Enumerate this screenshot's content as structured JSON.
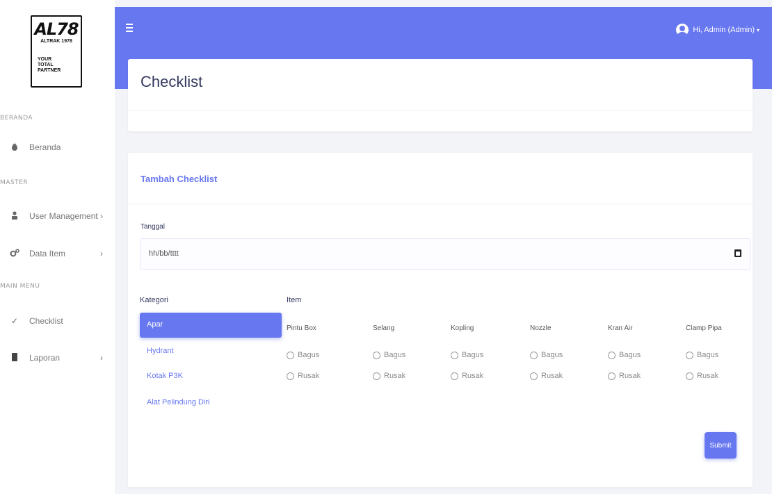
{
  "brand": {
    "logo_main": "AL78",
    "logo_sub": "ALTRAK 1978",
    "tagline": "YOUR\nTOTAL\nPARTNER"
  },
  "sidebar": {
    "sections": [
      "BERANDA",
      "MASTER",
      "MAIN MENU"
    ],
    "items": [
      {
        "label": "Beranda",
        "icon": "fire-icon"
      },
      {
        "label": "User Management",
        "icon": "user-icon"
      },
      {
        "label": "Data Item",
        "icon": "cogs-icon"
      },
      {
        "label": "Checklist",
        "icon": "check-icon"
      },
      {
        "label": "Laporan",
        "icon": "book-icon"
      }
    ]
  },
  "topbar": {
    "user_label": "Hi, Admin (Admin)",
    "accent": "#6777ef"
  },
  "page": {
    "title": "Checklist"
  },
  "form": {
    "card_title": "Tambah Checklist",
    "date_label": "Tanggal",
    "date_value": "hh/bb/tttt",
    "kategori_label": "Kategori",
    "item_label": "Item",
    "categories": [
      "Apar",
      "Hydrant",
      "Kotak P3K",
      "Alat Pelindung Diri"
    ],
    "active_category": "Apar",
    "items": [
      {
        "name": "Pintu Box",
        "good": "Bagus",
        "bad": "Rusak"
      },
      {
        "name": "Selang",
        "good": "Bagus",
        "bad": "Rusak"
      },
      {
        "name": "Kopling",
        "good": "Bagus",
        "bad": "Rusak"
      },
      {
        "name": "Nozzle",
        "good": "Bagus",
        "bad": "Rusak"
      },
      {
        "name": "Kran Air",
        "good": "Bagus",
        "bad": "Rusak"
      },
      {
        "name": "Clamp Pipa",
        "good": "Bagus",
        "bad": "Rusak"
      }
    ],
    "submit_label": "Submit"
  }
}
